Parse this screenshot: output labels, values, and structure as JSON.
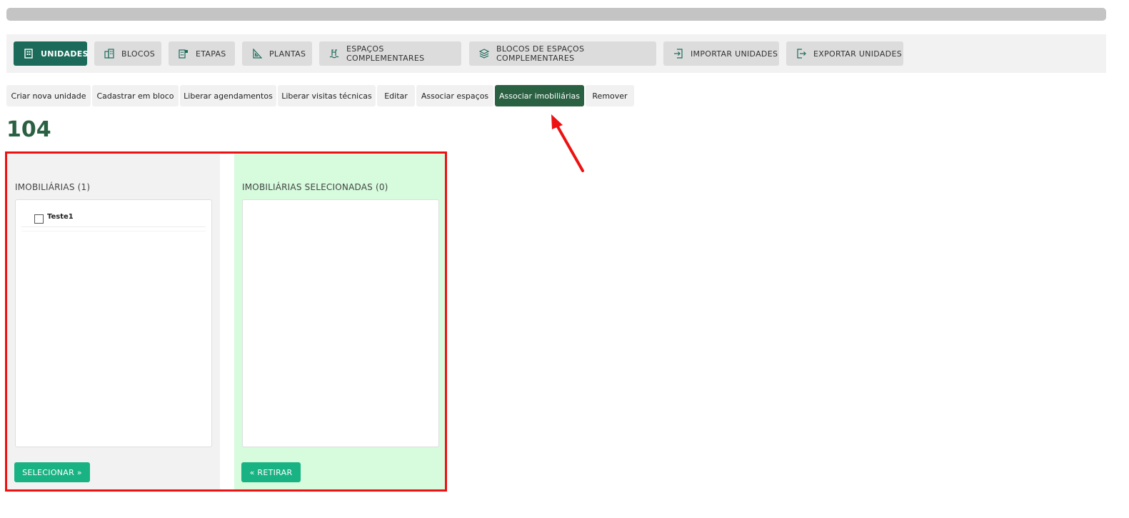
{
  "tabs": [
    {
      "label": "UNIDADES",
      "icon": "building-icon",
      "active": true
    },
    {
      "label": "BLOCOS",
      "icon": "buildings-icon",
      "active": false
    },
    {
      "label": "ETAPAS",
      "icon": "stages-icon",
      "active": false
    },
    {
      "label": "PLANTAS",
      "icon": "ruler-triangle-icon",
      "active": false
    },
    {
      "label": "ESPAÇOS COMPLEMENTARES",
      "icon": "pool-icon",
      "active": false
    },
    {
      "label": "BLOCOS DE ESPAÇOS COMPLEMENTARES",
      "icon": "layers-icon",
      "active": false
    },
    {
      "label": "IMPORTAR UNIDADES",
      "icon": "import-icon",
      "active": false
    },
    {
      "label": "EXPORTAR UNIDADES",
      "icon": "export-icon",
      "active": false
    }
  ],
  "actions": [
    {
      "label": "Criar nova unidade",
      "active": false
    },
    {
      "label": "Cadastrar em bloco",
      "active": false
    },
    {
      "label": "Liberar agendamentos",
      "active": false
    },
    {
      "label": "Liberar visitas técnicas",
      "active": false
    },
    {
      "label": "Editar",
      "active": false
    },
    {
      "label": "Associar espaços",
      "active": false
    },
    {
      "label": "Associar imobiliárias",
      "active": true
    },
    {
      "label": "Remover",
      "active": false
    }
  ],
  "unit_title": "104",
  "left_panel": {
    "title": "IMOBILIÁRIAS (1)",
    "items": [
      {
        "label": "Teste1",
        "checked": false
      }
    ],
    "button_label": "SELECIONAR »"
  },
  "right_panel": {
    "title": "IMOBILIÁRIAS SELECIONADAS (0)",
    "items": [],
    "button_label": "« RETIRAR"
  },
  "colors": {
    "primary_dark_green": "#1c6b5a",
    "action_active_green": "#2b6143",
    "button_green": "#19b383",
    "selected_panel_bg": "#d6fbdd",
    "highlight_red": "#ee1111"
  }
}
